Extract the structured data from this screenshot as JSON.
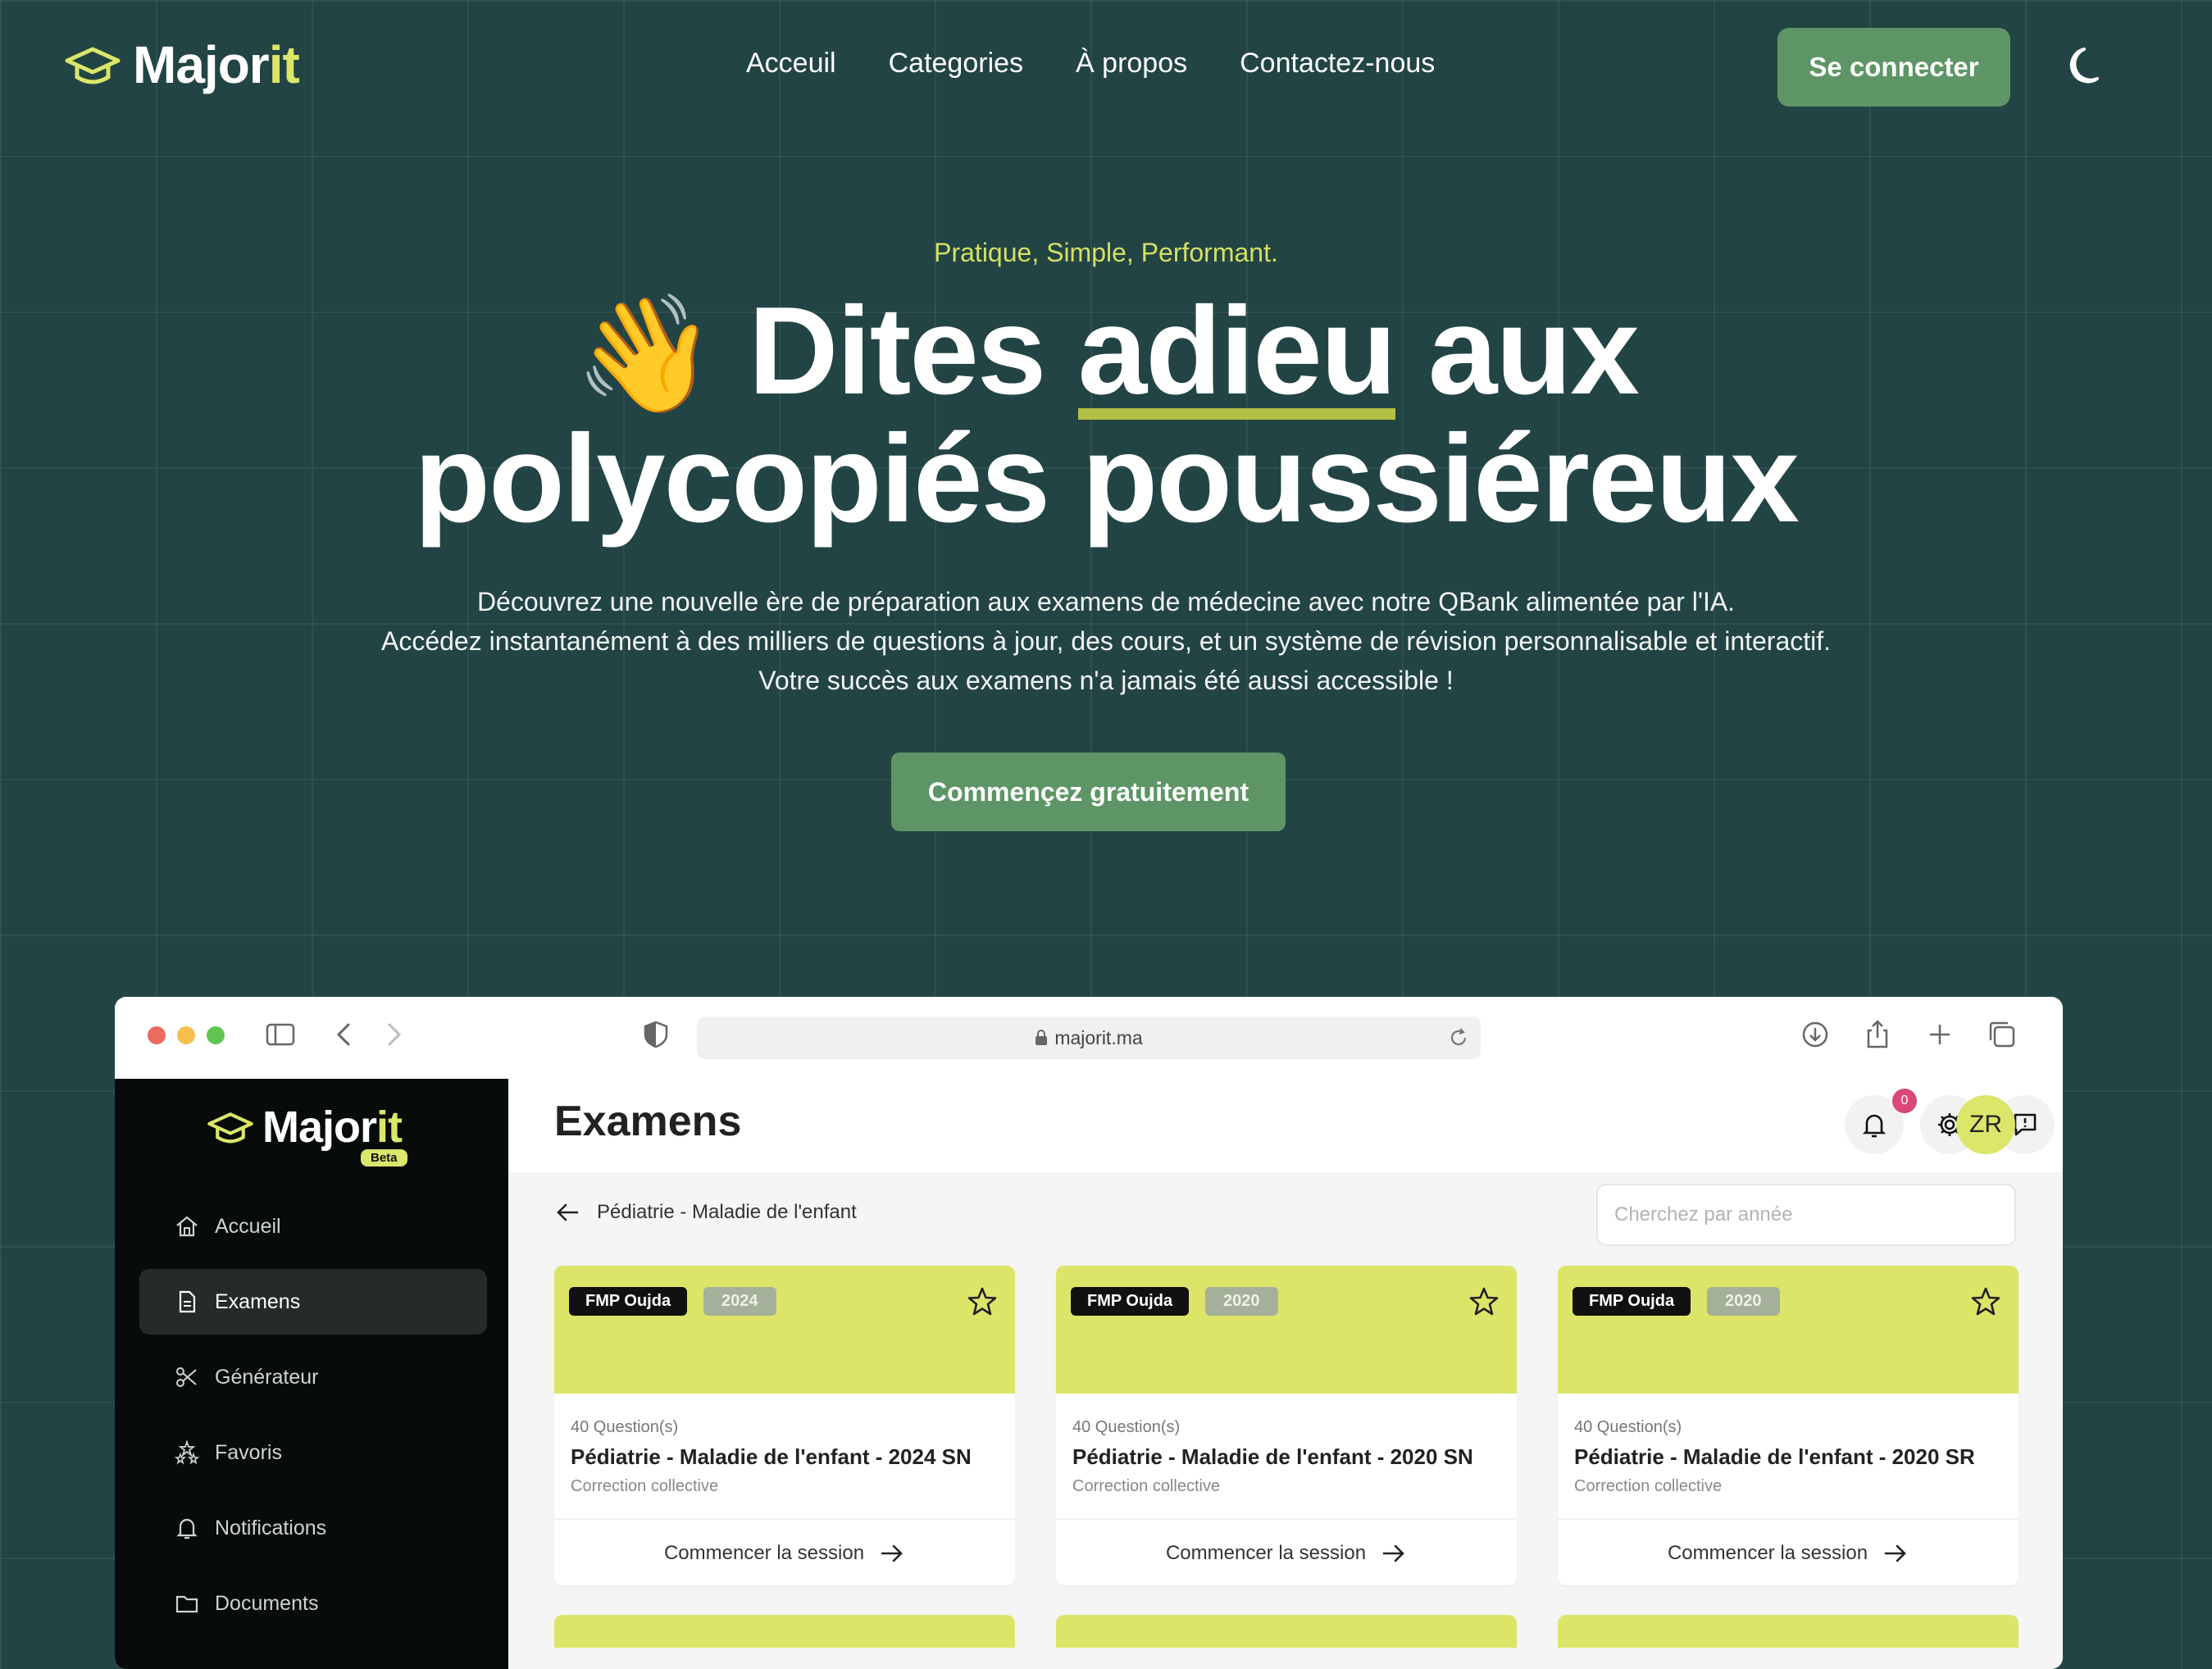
{
  "brand": {
    "name_main": "Major",
    "name_accent": "it"
  },
  "nav": {
    "items": [
      "Acceuil",
      "Categories",
      "À propos",
      "Contactez-nous"
    ]
  },
  "login_label": "Se connecter",
  "hero": {
    "tagline": "Pratique, Simple, Performant.",
    "wave": "👋",
    "h1_word1": "Dites",
    "h1_highlight": "adieu",
    "h1_word3": "aux",
    "h1_line2": "polycopiés poussiéreux",
    "desc_lines": [
      "Découvrez une nouvelle ère de préparation aux examens de médecine avec notre QBank alimentée par l'IA.",
      "Accédez instantanément à des milliers de questions à jour, des cours, et un système de révision personnalisable et interactif.",
      "Votre succès aux examens n'a jamais été aussi accessible !"
    ],
    "cta": "Commençez gratuitement"
  },
  "browser": {
    "url": "majorit.ma"
  },
  "app": {
    "logo_main": "Major",
    "logo_accent": "it",
    "beta": "Beta",
    "sidebar": [
      {
        "label": "Accueil",
        "icon": "home-icon"
      },
      {
        "label": "Examens",
        "icon": "document-icon",
        "active": true
      },
      {
        "label": "Générateur",
        "icon": "scissors-icon"
      },
      {
        "label": "Favoris",
        "icon": "stars-icon"
      },
      {
        "label": "Notifications",
        "icon": "bell-icon"
      },
      {
        "label": "Documents",
        "icon": "folder-icon"
      }
    ],
    "title": "Examens",
    "notif_count": "0",
    "avatar": "ZR",
    "breadcrumb": "Pédiatrie - Maladie de l'enfant",
    "search_placeholder": "Cherchez par année",
    "cards": [
      {
        "school": "FMP Oujda",
        "year": "2024",
        "questions": "40 Question(s)",
        "title": "Pédiatrie - Maladie de l'enfant - 2024 SN",
        "subtitle": "Correction collective",
        "action": "Commencer la session"
      },
      {
        "school": "FMP Oujda",
        "year": "2020",
        "questions": "40 Question(s)",
        "title": "Pédiatrie - Maladie de l'enfant - 2020 SN",
        "subtitle": "Correction collective",
        "action": "Commencer la session"
      },
      {
        "school": "FMP Oujda",
        "year": "2020",
        "questions": "40 Question(s)",
        "title": "Pédiatrie - Maladie de l'enfant - 2020 SR",
        "subtitle": "Correction collective",
        "action": "Commencer la session"
      }
    ]
  },
  "colors": {
    "bg": "#234444",
    "accent": "#dbe66a",
    "button": "#5e9566",
    "card_top": "#dde569"
  }
}
